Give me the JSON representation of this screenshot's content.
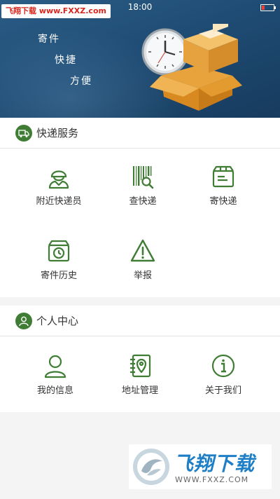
{
  "status_bar": {
    "time": "18:00"
  },
  "watermark_top": "飞翔下载 www.FXXZ.com",
  "banner": {
    "slogans": [
      "寄件",
      "快捷",
      "方便"
    ]
  },
  "services": {
    "title": "快递服务",
    "items": [
      {
        "label": "附近快递员",
        "icon": "courier-icon"
      },
      {
        "label": "查快递",
        "icon": "barcode-search-icon"
      },
      {
        "label": "寄快递",
        "icon": "package-icon"
      },
      {
        "label": "寄件历史",
        "icon": "history-box-icon"
      },
      {
        "label": "举报",
        "icon": "warning-icon"
      }
    ]
  },
  "personal": {
    "title": "个人中心",
    "items": [
      {
        "label": "我的信息",
        "icon": "user-icon"
      },
      {
        "label": "地址管理",
        "icon": "address-book-icon"
      },
      {
        "label": "关于我们",
        "icon": "info-icon"
      }
    ]
  },
  "watermark_bottom": {
    "brand": "飞翔下载",
    "url": "WWW.FXXZ.COM"
  },
  "colors": {
    "accent": "#3f7d34",
    "banner": "#1f4c74",
    "background": "#f4f4f4"
  }
}
